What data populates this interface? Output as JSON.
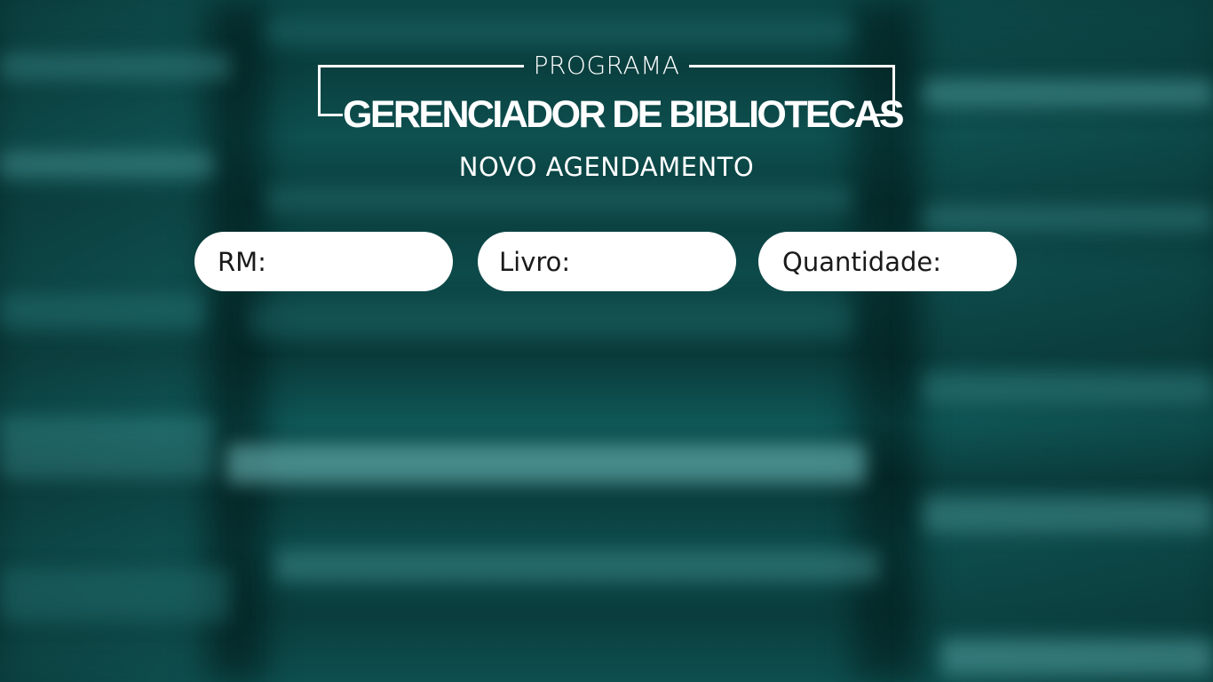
{
  "header": {
    "program_label": "PROGRAMA",
    "title": "GERENCIADOR DE BIBLIOTECAS",
    "subtitle": "NOVO AGENDAMENTO"
  },
  "form": {
    "fields": [
      {
        "label": "RM:",
        "value": "",
        "placeholder": ""
      },
      {
        "label": "Livro:",
        "value": "",
        "placeholder": ""
      },
      {
        "label": "Quantidade:",
        "value": "",
        "placeholder": ""
      }
    ]
  },
  "colors": {
    "background": "#0b4444",
    "field_background": "#ffffff",
    "text_light": "#ffffff",
    "text_dark": "#1a1a1a"
  }
}
